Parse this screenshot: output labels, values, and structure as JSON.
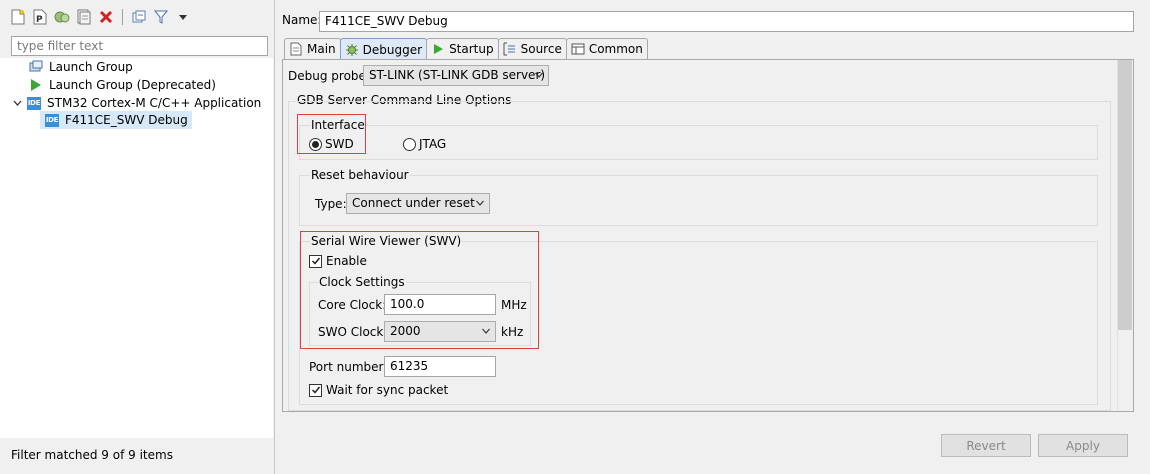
{
  "left": {
    "toolbar": {
      "icons": [
        "new-config-icon",
        "new-prototype-icon",
        "duplicate-icon",
        "export-icon",
        "delete-icon",
        "collapse-all-icon",
        "filter-icon",
        "view-menu-icon"
      ]
    },
    "filter_placeholder": "type filter text",
    "tree": [
      {
        "label": "Launch Group",
        "icon": "launch-group-icon"
      },
      {
        "label": "Launch Group (Deprecated)",
        "icon": "launch-deprecated-icon"
      },
      {
        "label": "STM32 Cortex-M C/C++ Application",
        "icon": "ide-icon"
      },
      {
        "label": "F411CE_SWV Debug",
        "icon": "ide-icon"
      }
    ],
    "ide_badge": "IDE",
    "status": "Filter matched 9 of 9 items"
  },
  "right": {
    "name_label": "Name:",
    "name_value": "F411CE_SWV Debug",
    "tabs": [
      {
        "label": "Main",
        "icon": "main-tab-icon"
      },
      {
        "label": "Debugger",
        "icon": "debugger-tab-icon"
      },
      {
        "label": "Startup",
        "icon": "startup-tab-icon"
      },
      {
        "label": "Source",
        "icon": "source-tab-icon"
      },
      {
        "label": "Common",
        "icon": "common-tab-icon"
      }
    ],
    "debug_probe_label": "Debug probe",
    "debug_probe_value": "ST-LINK (ST-LINK GDB server)",
    "gdb_group_title": "GDB Server Command Line Options",
    "interface": {
      "title": "Interface",
      "swd": "SWD",
      "jtag": "JTAG",
      "selected": "SWD"
    },
    "reset": {
      "title": "Reset behaviour",
      "type_label": "Type:",
      "type_value": "Connect under reset"
    },
    "swv": {
      "title": "Serial Wire Viewer (SWV)",
      "enable_label": "Enable",
      "enable_checked": true,
      "clock_title": "Clock Settings",
      "core_clock_label": "Core Clock:",
      "core_clock_value": "100.0",
      "core_clock_unit": "MHz",
      "swo_clock_label": "SWO Clock:",
      "swo_clock_value": "2000",
      "swo_clock_unit": "kHz"
    },
    "port_label": "Port number:",
    "port_value": "61235",
    "wait_sync_label": "Wait for sync packet",
    "wait_sync_checked": true,
    "buttons": {
      "revert": "Revert",
      "apply": "Apply"
    }
  },
  "colors": {
    "highlight_red": "#e04040",
    "ide_blue": "#3a8fd6",
    "selection": "#d7e8f8"
  }
}
